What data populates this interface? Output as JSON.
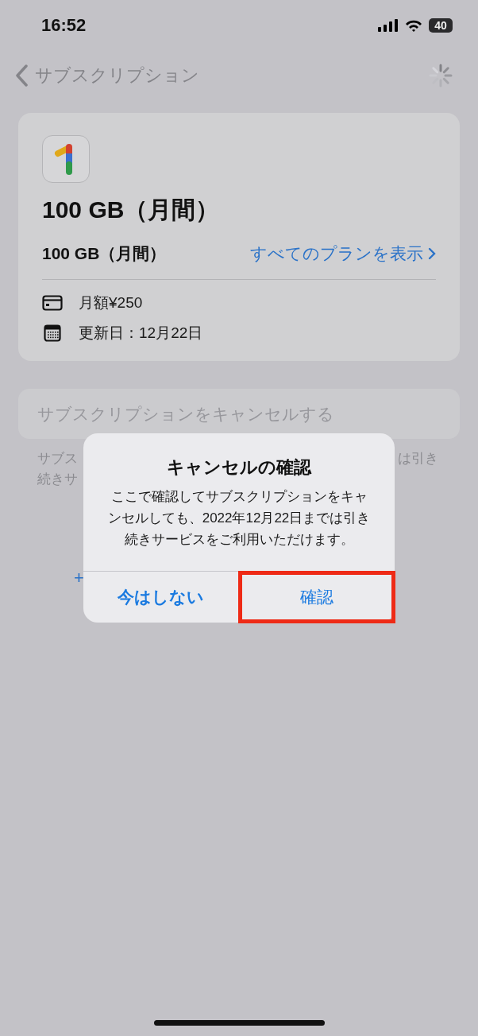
{
  "status_bar": {
    "time": "16:52",
    "battery": "40"
  },
  "nav": {
    "back_title": "サブスクリプション"
  },
  "plan_card": {
    "title": "100 GB（月間）",
    "plan_name": "100 GB（月間）",
    "view_all_link": "すべてのプランを表示",
    "details": [
      {
        "kind": "card",
        "text": "月額¥250"
      },
      {
        "kind": "calendar",
        "text": "更新日：12月22日"
      }
    ]
  },
  "cancel_button": {
    "label": "サブスクリプションをキャンセルする",
    "disabled": true
  },
  "caption_fragments": {
    "left_lines": [
      "サブス",
      "続きサ"
    ],
    "right": "は引き"
  },
  "link_fragment": "+",
  "dialog": {
    "title": "キャンセルの確認",
    "message": "ここで確認してサブスクリプションをキャンセルしても、2022年12月22日までは引き続きサービスをご利用いただけます。",
    "actions": [
      {
        "label": "今はしない",
        "bold": true,
        "highlighted": false
      },
      {
        "label": "確認",
        "bold": false,
        "highlighted": true
      }
    ]
  }
}
